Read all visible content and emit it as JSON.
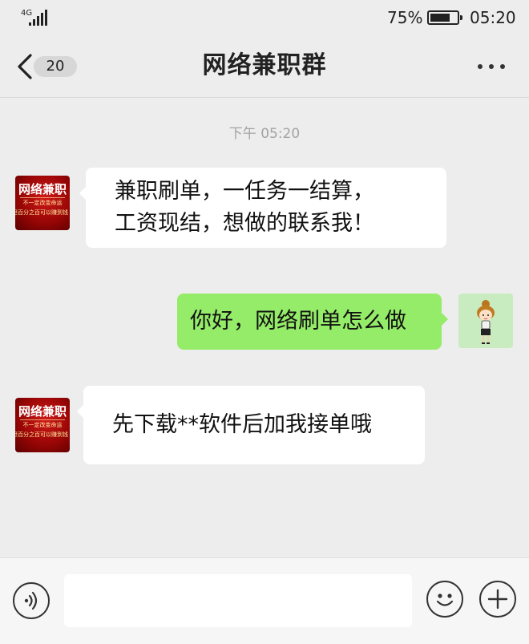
{
  "status_bar": {
    "network": "4G",
    "battery_percent": "75%",
    "battery_level": 0.75,
    "time": "05:20"
  },
  "header": {
    "unread_count": "20",
    "title": "网络兼职群"
  },
  "chat": {
    "timestamp": "下午 05:20",
    "group_avatar": {
      "title": "网络兼职",
      "line1": "不一定改变命运",
      "line2": "但百分之百可以赚到钱"
    },
    "messages": [
      {
        "sender": "group",
        "line1": "兼职刷单，一任务一结算，",
        "line2": "工资现结，想做的联系我！"
      },
      {
        "sender": "me",
        "text": "你好，网络刷单怎么做"
      },
      {
        "sender": "group",
        "text": "先下载**软件后加我接单哦"
      }
    ]
  },
  "input_bar": {
    "value": "",
    "placeholder": ""
  },
  "colors": {
    "background": "#ededed",
    "bubble_incoming": "#ffffff",
    "bubble_outgoing": "#95ec69",
    "timestamp_text": "#a3a3a3"
  },
  "icons": [
    "back-arrow-icon",
    "more-icon",
    "voice-icon",
    "emoji-icon",
    "plus-icon",
    "signal-icon",
    "battery-icon"
  ]
}
